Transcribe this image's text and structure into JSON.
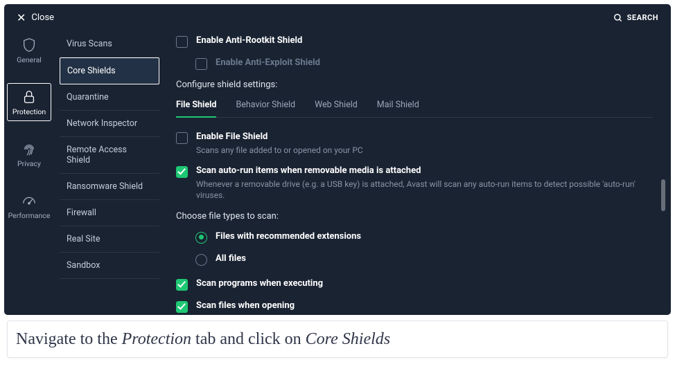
{
  "topbar": {
    "close": "Close",
    "search": "SEARCH"
  },
  "cats": [
    {
      "id": "general",
      "label": "General"
    },
    {
      "id": "protection",
      "label": "Protection"
    },
    {
      "id": "privacy",
      "label": "Privacy"
    },
    {
      "id": "performance",
      "label": "Performance"
    }
  ],
  "subnav": [
    "Virus Scans",
    "Core Shields",
    "Quarantine",
    "Network Inspector",
    "Remote Access Shield",
    "Ransomware Shield",
    "Firewall",
    "Real Site",
    "Sandbox"
  ],
  "options": {
    "rootkit": "Enable Anti-Rootkit Shield",
    "exploit": "Enable Anti-Exploit Shield"
  },
  "configure": "Configure shield settings:",
  "tabs": [
    "File Shield",
    "Behavior Shield",
    "Web Shield",
    "Mail Shield"
  ],
  "fileShield": {
    "enable_label": "Enable File Shield",
    "enable_desc": "Scans any file added to or opened on your PC",
    "autorun_label": "Scan auto-run items when removable media is attached",
    "autorun_desc": "Whenever a removable drive (e.g. a USB key) is attached, Avast will scan any auto-run items to detect possible 'auto-run' viruses.",
    "choose": "Choose file types to scan:",
    "ext_label": "Files with recommended extensions",
    "all_label": "All files",
    "exec_label": "Scan programs when executing",
    "open_label": "Scan files when opening"
  },
  "caption": {
    "p1": "Navigate to the ",
    "p2": "Protection",
    "p3": " tab and click on ",
    "p4": "Core Shields"
  },
  "colors": {
    "accent": "#1ec773",
    "bg": "#1a2332"
  }
}
